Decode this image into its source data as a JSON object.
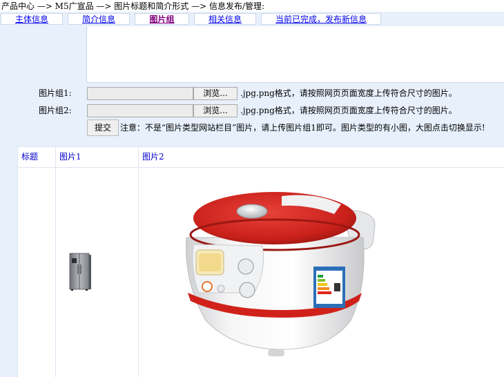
{
  "breadcrumb": "产品中心 —> M5广宣品 —> 图片标题和简介形式 —> 信息发布/管理:",
  "tabs": [
    {
      "label": "主体信息",
      "active": false
    },
    {
      "label": "简介信息",
      "active": false
    },
    {
      "label": "图片组",
      "active": true
    },
    {
      "label": "相关信息",
      "active": false
    },
    {
      "label": "当前已完成，发布新信息",
      "active": false
    }
  ],
  "upload": {
    "rows": [
      {
        "label": "图片组1:",
        "browse_label": "浏览...",
        "hint": ".jpg.png格式，请按照网页页面宽度上传符合尺寸的图片。"
      },
      {
        "label": "图片组2:",
        "browse_label": "浏览...",
        "hint": ".jpg.png格式，请按照网页页面宽度上传符合尺寸的图片。"
      }
    ],
    "submit_label": "提交",
    "note": "注意：不是“图片类型网站栏目”图片，请上传图片组1即可。图片类型的有小图，大图点击切换显示!"
  },
  "table": {
    "headers": [
      "标题",
      "图片1",
      "图片2"
    ],
    "rows": [
      {
        "title": "",
        "image1": "refrigerator-image",
        "image2": "rice-cooker-image"
      }
    ]
  },
  "colors": {
    "panel_bg": "#e8f0fc",
    "link": "#0000ee",
    "active_tab": "#800080",
    "cooker_red": "#d0221a"
  }
}
